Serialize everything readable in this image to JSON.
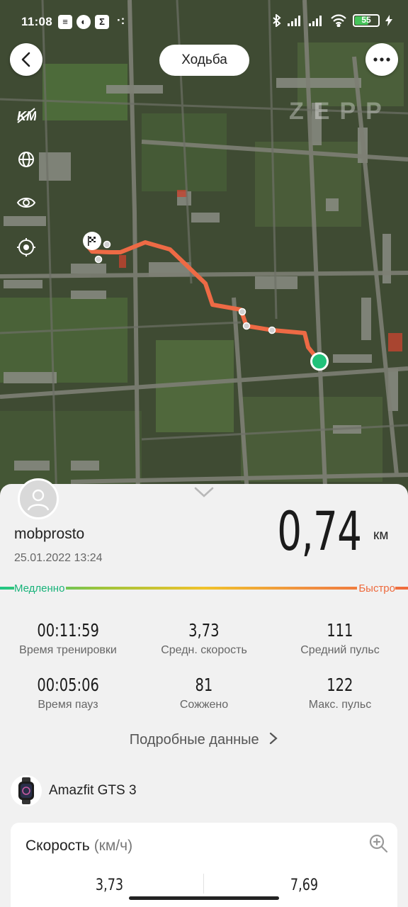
{
  "status_bar": {
    "time": "11:08",
    "battery_level": "55",
    "icons": [
      "message-icon",
      "app-icon",
      "sigma-icon",
      "bluetooth-icon",
      "signal-icon",
      "signal-icon",
      "wifi-icon",
      "battery-icon",
      "charging-icon"
    ]
  },
  "header": {
    "activity": "Ходьба",
    "watermark": "ZEPP"
  },
  "map": {
    "side_icons": [
      "km-markers-icon",
      "globe-icon",
      "eye-icon",
      "locate-icon"
    ],
    "route_color": "#ee6a45",
    "end_marker_color": "#21c27a"
  },
  "summary": {
    "username": "mobprosto",
    "datetime": "25.01.2022 13:24",
    "distance": "0,74",
    "unit": "км",
    "slow_label": "Медленно",
    "fast_label": "Быстро"
  },
  "stats": [
    {
      "value": "00:11:59",
      "label": "Время тренировки"
    },
    {
      "value": "3,73",
      "label": "Средн. скорость"
    },
    {
      "value": "111",
      "label": "Средний пульс"
    },
    {
      "value": "00:05:06",
      "label": "Время пауз"
    },
    {
      "value": "81",
      "label": "Сожжено"
    },
    {
      "value": "122",
      "label": "Макс. пульс"
    }
  ],
  "details_link": "Подробные данные",
  "device": {
    "name": "Amazfit GTS 3"
  },
  "speed_card": {
    "title": "Скорость",
    "unit": "(км/ч)",
    "avg": "3,73",
    "max": "7,69"
  }
}
